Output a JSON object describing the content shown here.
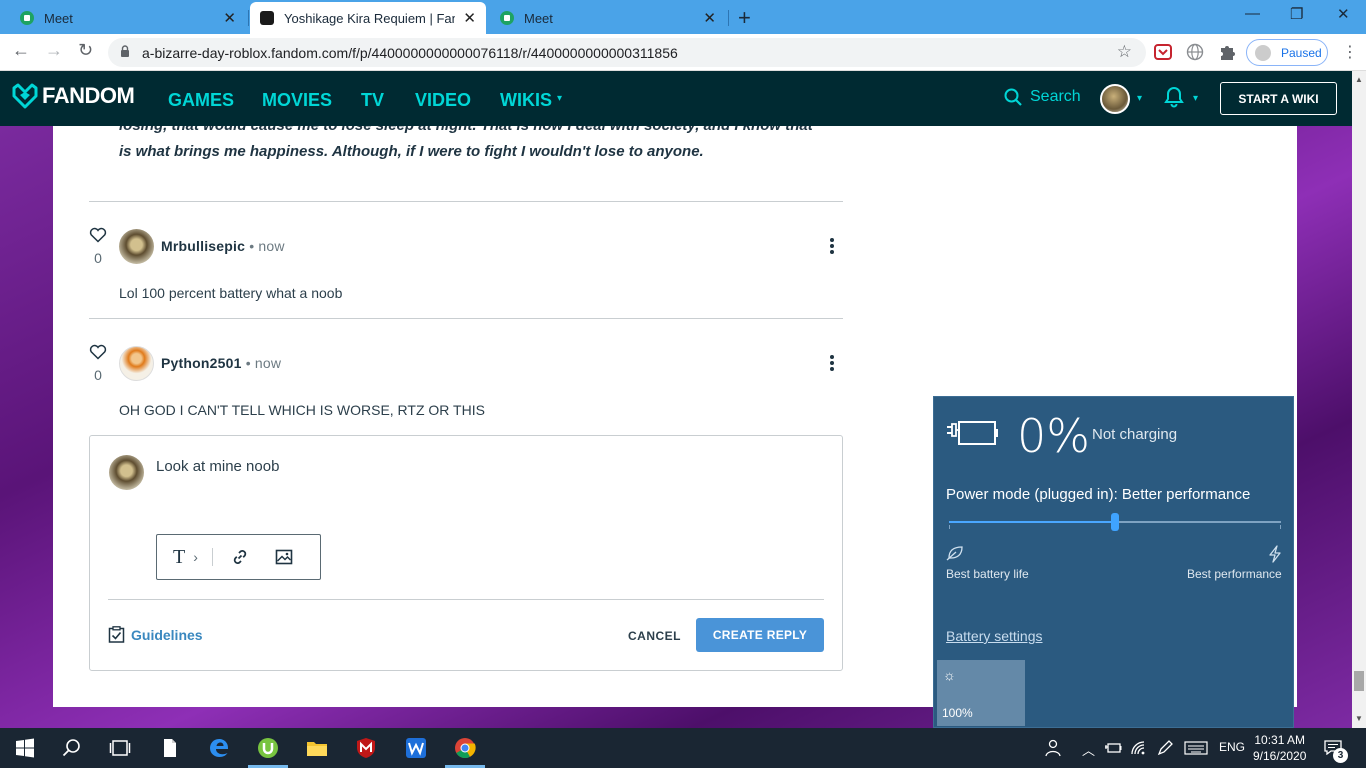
{
  "browser": {
    "tabs": [
      {
        "title": "Meet",
        "close": "✕"
      },
      {
        "title": "Yoshikage Kira Requiem | Fandom",
        "close": "✕"
      },
      {
        "title": "Meet",
        "close": "✕"
      }
    ],
    "new_tab": "+",
    "window_controls": {
      "minimize": "—",
      "restore": "❐",
      "close": "✕"
    },
    "url": "a-bizarre-day-roblox.fandom.com/f/p/4400000000000076118/r/4400000000000311856",
    "profile_status": "Paused",
    "nav": {
      "back": "←",
      "forward": "→",
      "reload": "↻",
      "star": "☆",
      "menu": "⋮"
    }
  },
  "fandom_nav": {
    "logo": "FANDOM",
    "links": [
      "GAMES",
      "MOVIES",
      "TV",
      "VIDEO",
      "WIKIS"
    ],
    "wikis_caret": "▾",
    "search": "Search",
    "start_wiki": "START A WIKI",
    "caret": "▾"
  },
  "thread": {
    "quote_text": "losing, that would cause me to lose sleep at night. That is how I deal with society, and I know that is what brings me happiness. Although, if I were to fight I wouldn't lose to anyone.",
    "comments": [
      {
        "likes": "0",
        "author": "Mrbullisepic",
        "time": "• now",
        "text": "Lol 100 percent battery what a noob"
      },
      {
        "likes": "0",
        "author": "Python2501",
        "time": "• now",
        "text": "OH GOD I CAN'T TELL WHICH IS WORSE, RTZ OR THIS"
      }
    ],
    "reply": {
      "text": "Look at mine noob",
      "tool_text": "T",
      "tool_chevron": "›",
      "guidelines": "Guidelines",
      "cancel": "CANCEL",
      "create": "CREATE REPLY"
    }
  },
  "battery_flyout": {
    "percent": "0%",
    "status": "Not charging",
    "power_mode": "Power mode (plugged in): Better performance",
    "slider_level": 0.5,
    "left_label": "Best battery life",
    "right_label": "Best performance",
    "settings_link": "Battery settings",
    "brightness_icon": "☼",
    "brightness": "100%"
  },
  "taskbar": {
    "language": "ENG",
    "time": "10:31 AM",
    "date": "9/16/2020",
    "notifications": "3"
  },
  "colors": {
    "chrome_tab_strip": "#4aa3e8",
    "fandom_nav": "#002a32",
    "fandom_accent": "#00d6d6",
    "link_blue": "#3a88bf",
    "button_blue": "#4a94d8",
    "flyout_bg": "#2b5a80",
    "taskbar": "#1a2633"
  }
}
